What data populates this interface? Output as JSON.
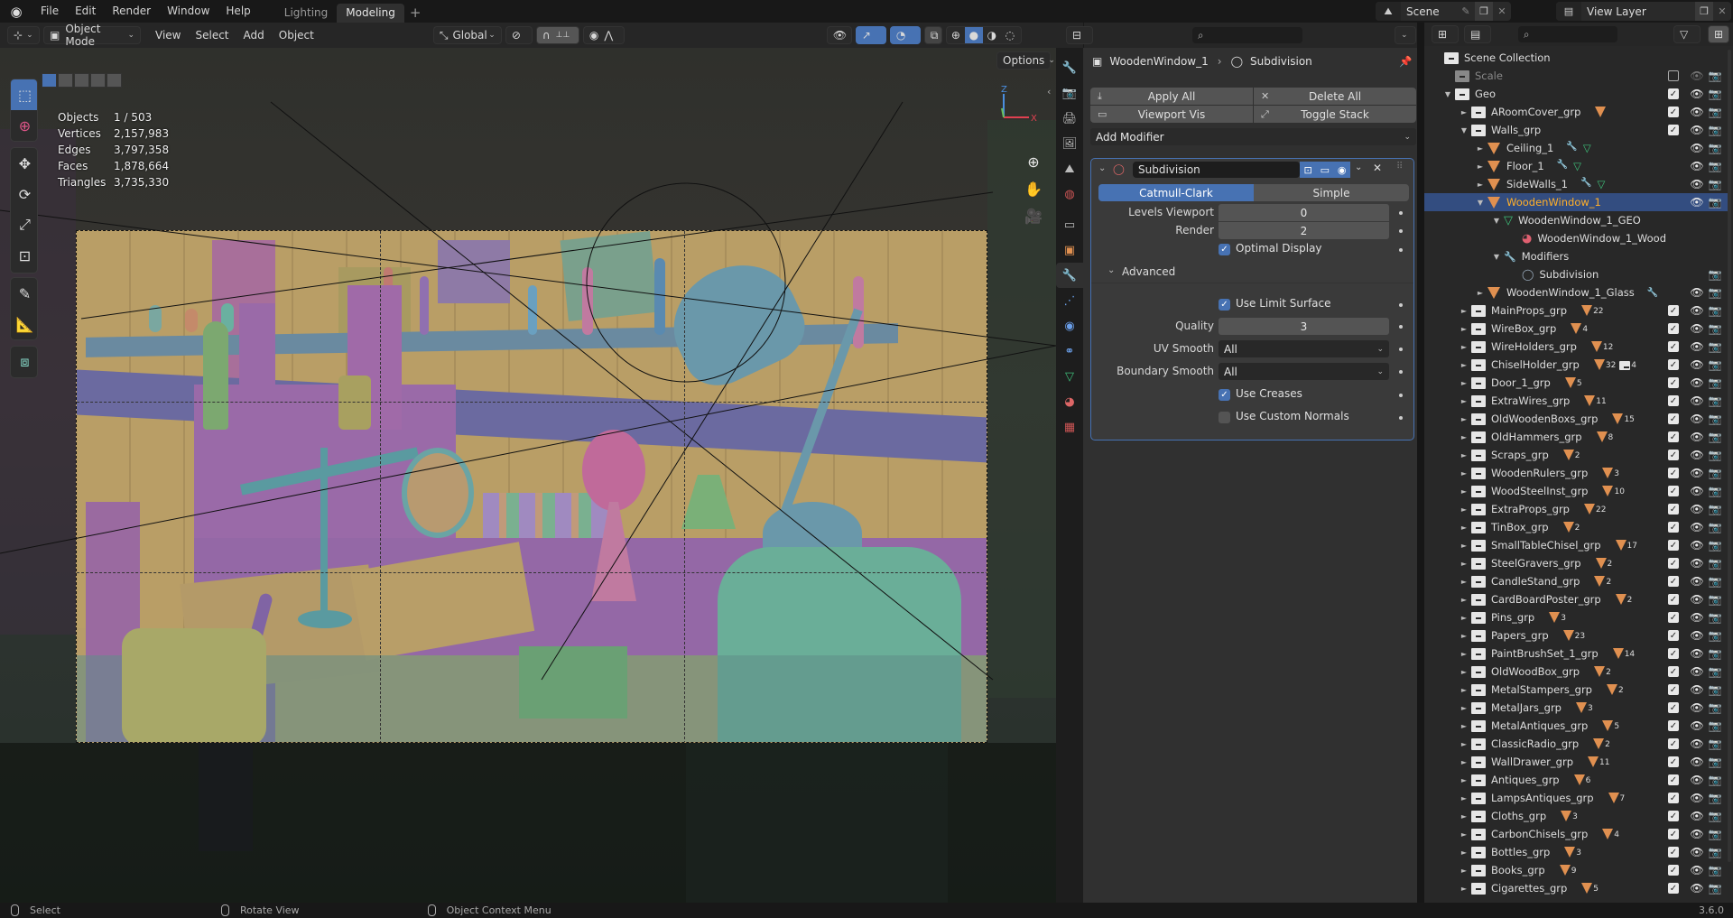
{
  "topbar": {
    "menu": [
      "File",
      "Edit",
      "Render",
      "Window",
      "Help"
    ],
    "workspaces": [
      {
        "label": "Lighting",
        "active": false
      },
      {
        "label": "Modeling",
        "active": true
      }
    ],
    "add_workspace": "+",
    "scene": "Scene",
    "view_layer": "View Layer"
  },
  "viewport": {
    "mode": "Object Mode",
    "menus": [
      "View",
      "Select",
      "Add",
      "Object"
    ],
    "orientation": "Global",
    "options_label": "Options",
    "stats": [
      {
        "label": "Objects",
        "value": "1 / 503"
      },
      {
        "label": "Vertices",
        "value": "2,157,983"
      },
      {
        "label": "Edges",
        "value": "3,797,358"
      },
      {
        "label": "Faces",
        "value": "1,878,664"
      },
      {
        "label": "Triangles",
        "value": "3,735,330"
      }
    ],
    "gizmo": {
      "x_label": "X",
      "z_label": "Z"
    },
    "tools": [
      "select-box",
      "cursor",
      "move",
      "rotate",
      "scale",
      "transform",
      "annotate",
      "measure",
      "add-cube"
    ]
  },
  "properties": {
    "breadcrumb_object": "WoodenWindow_1",
    "breadcrumb_modifier": "Subdivision",
    "apply_all": "Apply All",
    "delete_all": "Delete All",
    "viewport_vis": "Viewport Vis",
    "toggle_stack": "Toggle Stack",
    "add_modifier": "Add Modifier",
    "modifier": {
      "name": "Subdivision",
      "type_options": [
        "Catmull-Clark",
        "Simple"
      ],
      "type_selected": "Catmull-Clark",
      "levels_viewport_label": "Levels Viewport",
      "levels_viewport": "0",
      "render_label": "Render",
      "render": "2",
      "optimal_display_label": "Optimal Display",
      "optimal_display": true,
      "advanced_label": "Advanced",
      "use_limit_surface_label": "Use Limit Surface",
      "use_limit_surface": true,
      "quality_label": "Quality",
      "quality": "3",
      "uv_smooth_label": "UV Smooth",
      "uv_smooth": "All",
      "boundary_smooth_label": "Boundary Smooth",
      "boundary_smooth": "All",
      "use_creases_label": "Use Creases",
      "use_creases": true,
      "use_custom_normals_label": "Use Custom Normals",
      "use_custom_normals": false
    }
  },
  "outliner": {
    "root": "Scene Collection",
    "rows": [
      {
        "name": "Scale",
        "type": "collection",
        "depth": 1,
        "dim": true,
        "expand": ""
      },
      {
        "name": "Geo",
        "type": "collection",
        "depth": 1,
        "expand": "open"
      },
      {
        "name": "ARoomCover_grp",
        "type": "collection",
        "depth": 2,
        "expand": "closed",
        "count": ""
      },
      {
        "name": "Walls_grp",
        "type": "collection",
        "depth": 2,
        "expand": "open"
      },
      {
        "name": "Ceiling_1",
        "type": "object",
        "depth": 3,
        "expand": "closed",
        "extras": "mod+mesh"
      },
      {
        "name": "Floor_1",
        "type": "object",
        "depth": 3,
        "expand": "closed",
        "extras": "mod+mesh"
      },
      {
        "name": "SideWalls_1",
        "type": "object",
        "depth": 3,
        "expand": "closed",
        "extras": "mod+mesh"
      },
      {
        "name": "WoodenWindow_1",
        "type": "object",
        "depth": 3,
        "expand": "open",
        "selected": true
      },
      {
        "name": "WoodenWindow_1_GEO",
        "type": "mesh",
        "depth": 4,
        "expand": "open"
      },
      {
        "name": "WoodenWindow_1_Wood",
        "type": "material",
        "depth": 5,
        "expand": ""
      },
      {
        "name": "Modifiers",
        "type": "modifiers",
        "depth": 4,
        "expand": "open"
      },
      {
        "name": "Subdivision",
        "type": "modifier",
        "depth": 5,
        "expand": ""
      },
      {
        "name": "WoodenWindow_1_Glass",
        "type": "object",
        "depth": 3,
        "expand": "closed",
        "extras": "mod"
      },
      {
        "name": "MainProps_grp",
        "type": "collection",
        "depth": 2,
        "expand": "closed",
        "count": "22"
      },
      {
        "name": "WireBox_grp",
        "type": "collection",
        "depth": 2,
        "expand": "closed",
        "count": "4"
      },
      {
        "name": "WireHolders_grp",
        "type": "collection",
        "depth": 2,
        "expand": "closed",
        "count": "12"
      },
      {
        "name": "ChiselHolder_grp",
        "type": "collection",
        "depth": 2,
        "expand": "closed",
        "count": "32",
        "subcoll": "4"
      },
      {
        "name": "Door_1_grp",
        "type": "collection",
        "depth": 2,
        "expand": "closed",
        "count": "5"
      },
      {
        "name": "ExtraWires_grp",
        "type": "collection",
        "depth": 2,
        "expand": "closed",
        "count": "11"
      },
      {
        "name": "OldWoodenBoxs_grp",
        "type": "collection",
        "depth": 2,
        "expand": "closed",
        "count": "15"
      },
      {
        "name": "OldHammers_grp",
        "type": "collection",
        "depth": 2,
        "expand": "closed",
        "count": "8"
      },
      {
        "name": "Scraps_grp",
        "type": "collection",
        "depth": 2,
        "expand": "closed",
        "count": "2"
      },
      {
        "name": "WoodenRulers_grp",
        "type": "collection",
        "depth": 2,
        "expand": "closed",
        "count": "3"
      },
      {
        "name": "WoodSteelInst_grp",
        "type": "collection",
        "depth": 2,
        "expand": "closed",
        "count": "10"
      },
      {
        "name": "ExtraProps_grp",
        "type": "collection",
        "depth": 2,
        "expand": "closed",
        "count": "22"
      },
      {
        "name": "TinBox_grp",
        "type": "collection",
        "depth": 2,
        "expand": "closed",
        "count": "2"
      },
      {
        "name": "SmallTableChisel_grp",
        "type": "collection",
        "depth": 2,
        "expand": "closed",
        "count": "17"
      },
      {
        "name": "SteelGravers_grp",
        "type": "collection",
        "depth": 2,
        "expand": "closed",
        "count": "2"
      },
      {
        "name": "CandleStand_grp",
        "type": "collection",
        "depth": 2,
        "expand": "closed",
        "count": "2"
      },
      {
        "name": "CardBoardPoster_grp",
        "type": "collection",
        "depth": 2,
        "expand": "closed",
        "count": "2"
      },
      {
        "name": "Pins_grp",
        "type": "collection",
        "depth": 2,
        "expand": "closed",
        "count": "3"
      },
      {
        "name": "Papers_grp",
        "type": "collection",
        "depth": 2,
        "expand": "closed",
        "count": "23"
      },
      {
        "name": "PaintBrushSet_1_grp",
        "type": "collection",
        "depth": 2,
        "expand": "closed",
        "count": "14"
      },
      {
        "name": "OldWoodBox_grp",
        "type": "collection",
        "depth": 2,
        "expand": "closed",
        "count": "2"
      },
      {
        "name": "MetalStampers_grp",
        "type": "collection",
        "depth": 2,
        "expand": "closed",
        "count": "2"
      },
      {
        "name": "MetalJars_grp",
        "type": "collection",
        "depth": 2,
        "expand": "closed",
        "count": "3"
      },
      {
        "name": "MetalAntiques_grp",
        "type": "collection",
        "depth": 2,
        "expand": "closed",
        "count": "5"
      },
      {
        "name": "ClassicRadio_grp",
        "type": "collection",
        "depth": 2,
        "expand": "closed",
        "count": "2"
      },
      {
        "name": "WallDrawer_grp",
        "type": "collection",
        "depth": 2,
        "expand": "closed",
        "count": "11"
      },
      {
        "name": "Antiques_grp",
        "type": "collection",
        "depth": 2,
        "expand": "closed",
        "count": "6"
      },
      {
        "name": "LampsAntiques_grp",
        "type": "collection",
        "depth": 2,
        "expand": "closed",
        "count": "7"
      },
      {
        "name": "Cloths_grp",
        "type": "collection",
        "depth": 2,
        "expand": "closed",
        "count": "3"
      },
      {
        "name": "CarbonChisels_grp",
        "type": "collection",
        "depth": 2,
        "expand": "closed",
        "count": "4"
      },
      {
        "name": "Bottles_grp",
        "type": "collection",
        "depth": 2,
        "expand": "closed",
        "count": "3"
      },
      {
        "name": "Books_grp",
        "type": "collection",
        "depth": 2,
        "expand": "closed",
        "count": "9"
      },
      {
        "name": "Cigarettes_grp",
        "type": "collection",
        "depth": 2,
        "expand": "closed",
        "count": "5"
      }
    ]
  },
  "statusbar": {
    "left_hint": "Select",
    "middle_hint": "Rotate View",
    "right_hint": "Object Context Menu",
    "version": "3.6.0"
  },
  "colors": {
    "accent": "#4772b3",
    "selection_row": "#334d80",
    "object_orange": "#e09050",
    "selected_text": "#ffaf29"
  }
}
